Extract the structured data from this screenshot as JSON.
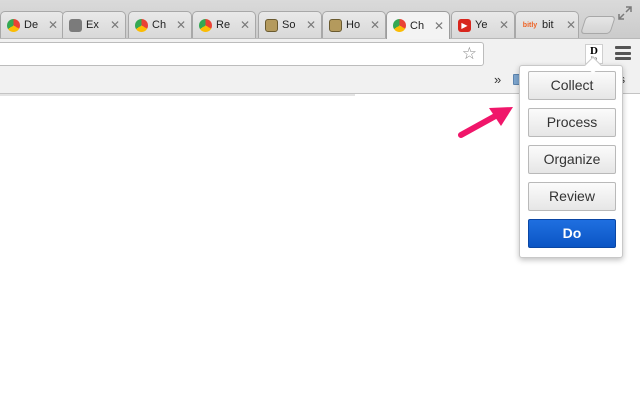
{
  "tabs": [
    {
      "title": "De",
      "favicon": "chrome-icon"
    },
    {
      "title": "Ex",
      "favicon": "puzzle-icon"
    },
    {
      "title": "Ch",
      "favicon": "chrome-icon"
    },
    {
      "title": "Re",
      "favicon": "chrome-icon"
    },
    {
      "title": "So",
      "favicon": "owl-icon"
    },
    {
      "title": "Ho",
      "favicon": "owl-icon"
    },
    {
      "title": "Ch",
      "favicon": "chrome-icon",
      "active": true
    },
    {
      "title": "Ye",
      "favicon": "youtube-icon"
    },
    {
      "title": "bit",
      "favicon": "bitly-icon",
      "favicon_text": "bitly"
    }
  ],
  "close_glyph": "✕",
  "toolbar": {
    "extension_letter": "D",
    "extension_sub": "Do"
  },
  "bookmarks": {
    "overflow_glyph": "»",
    "label": "ks"
  },
  "popup": {
    "buttons": [
      {
        "label": "Collect"
      },
      {
        "label": "Process"
      },
      {
        "label": "Organize"
      },
      {
        "label": "Review"
      },
      {
        "label": "Do",
        "primary": true
      }
    ]
  },
  "colors": {
    "accent": "#0b55c4",
    "annotation": "#f0166a"
  }
}
